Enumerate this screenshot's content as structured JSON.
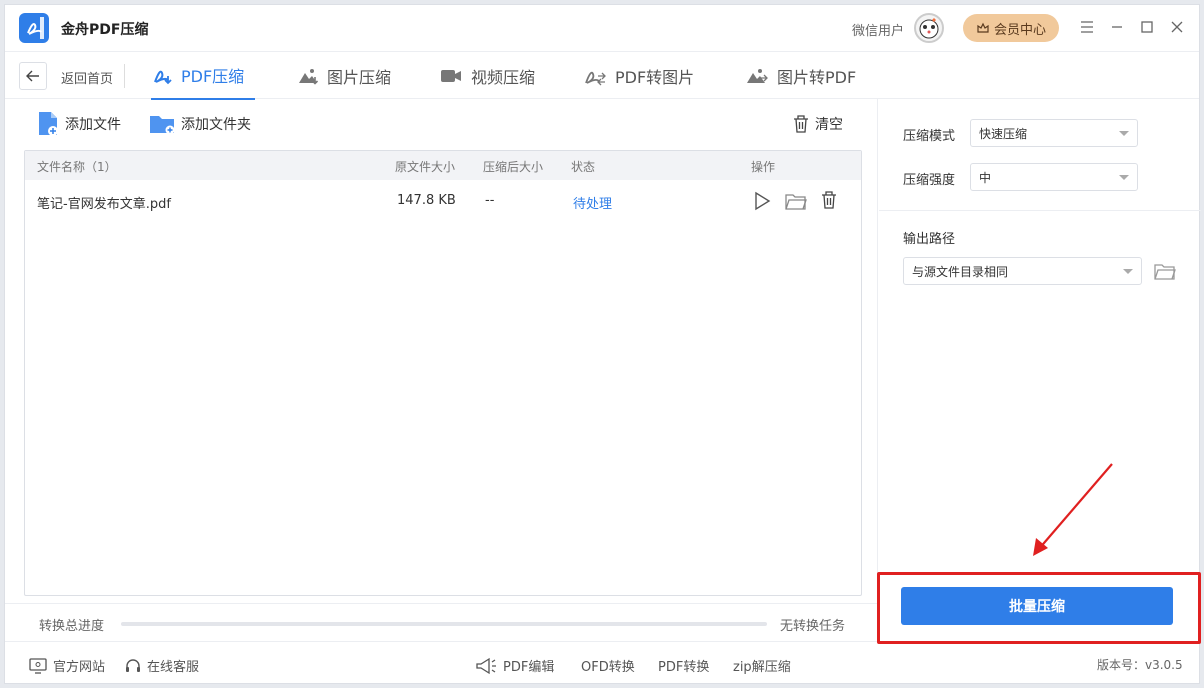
{
  "app": {
    "title": "金舟PDF压缩"
  },
  "user": {
    "name": "微信用户",
    "vip_label": "会员中心"
  },
  "nav": {
    "back_label": "返回首页",
    "tabs": [
      {
        "label": "PDF压缩",
        "active": true
      },
      {
        "label": "图片压缩"
      },
      {
        "label": "视频压缩"
      },
      {
        "label": "PDF转图片"
      },
      {
        "label": "图片转PDF"
      }
    ]
  },
  "toolbar": {
    "add_file": "添加文件",
    "add_folder": "添加文件夹",
    "clear": "清空"
  },
  "table": {
    "headers": {
      "name": "文件名称（1）",
      "orig_size": "原文件大小",
      "comp_size": "压缩后大小",
      "status": "状态",
      "ops": "操作"
    },
    "rows": [
      {
        "name": "笔记-官网发布文章.pdf",
        "orig_size": "147.8 KB",
        "comp_size": "--",
        "status": "待处理"
      }
    ]
  },
  "progress": {
    "label": "转换总进度",
    "value": 0,
    "status": "无转换任务"
  },
  "settings": {
    "mode_label": "压缩模式",
    "mode_value": "快速压缩",
    "strength_label": "压缩强度",
    "strength_value": "中",
    "output_label": "输出路径",
    "output_value": "与源文件目录相同"
  },
  "action": {
    "batch_label": "批量压缩"
  },
  "footer": {
    "website": "官方网站",
    "support": "在线客服",
    "links": [
      "PDF编辑",
      "OFD转换",
      "PDF转换",
      "zip解压缩"
    ],
    "version": "版本号：v3.0.5"
  },
  "colors": {
    "accent": "#2f7ee8",
    "highlight": "#e02020",
    "vip": "#f1c99b"
  }
}
